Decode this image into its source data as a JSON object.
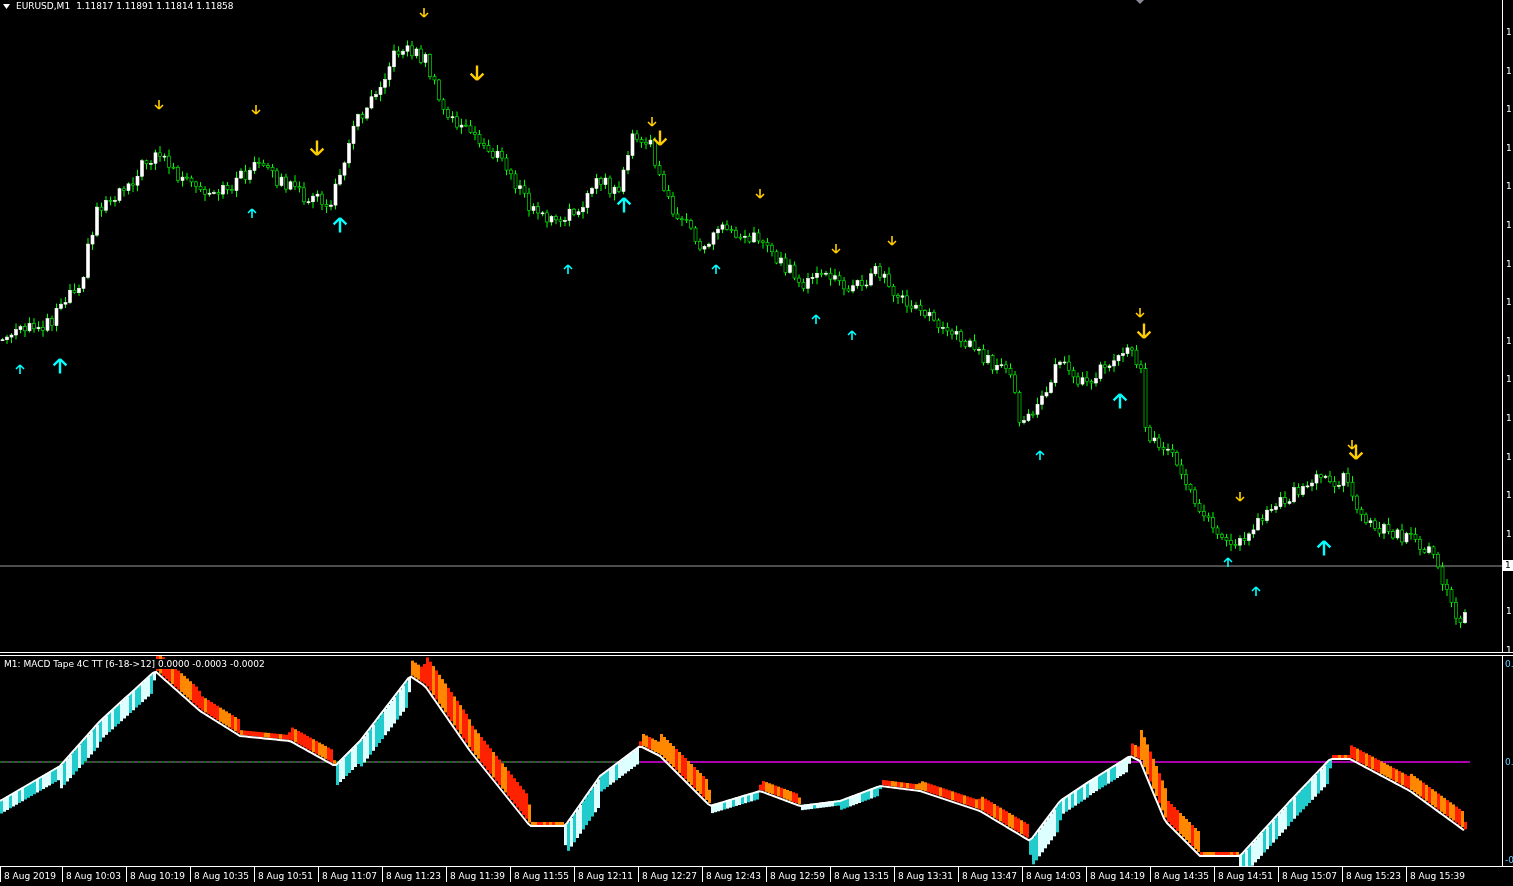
{
  "chart_header": {
    "symbol": "EURUSD,M1",
    "ohlc": "1.11817 1.11891 1.11814 1.11858"
  },
  "price_axis": {
    "labels": [
      "1",
      "1",
      "1",
      "1",
      "1",
      "1",
      "1",
      "1",
      "1",
      "1",
      "1",
      "1",
      "1",
      "1",
      "1",
      "1"
    ],
    "current_price_tag": "1"
  },
  "indicator": {
    "label": "M1: MACD Tape 4C TT [6-18->12] 0.0000 -0.0003 -0.0002",
    "axis_labels": [
      "0.",
      "0.",
      "-0"
    ]
  },
  "time_axis": {
    "labels": [
      "8 Aug 2019",
      "8 Aug 10:03",
      "8 Aug 10:19",
      "8 Aug 10:35",
      "8 Aug 10:51",
      "8 Aug 11:07",
      "8 Aug 11:23",
      "8 Aug 11:39",
      "8 Aug 11:55",
      "8 Aug 12:11",
      "8 Aug 12:27",
      "8 Aug 12:43",
      "8 Aug 12:59",
      "8 Aug 13:15",
      "8 Aug 13:31",
      "8 Aug 13:47",
      "8 Aug 14:03",
      "8 Aug 14:19",
      "8 Aug 14:35",
      "8 Aug 14:51",
      "8 Aug 15:07",
      "8 Aug 15:23",
      "8 Aug 15:39"
    ]
  }
}
